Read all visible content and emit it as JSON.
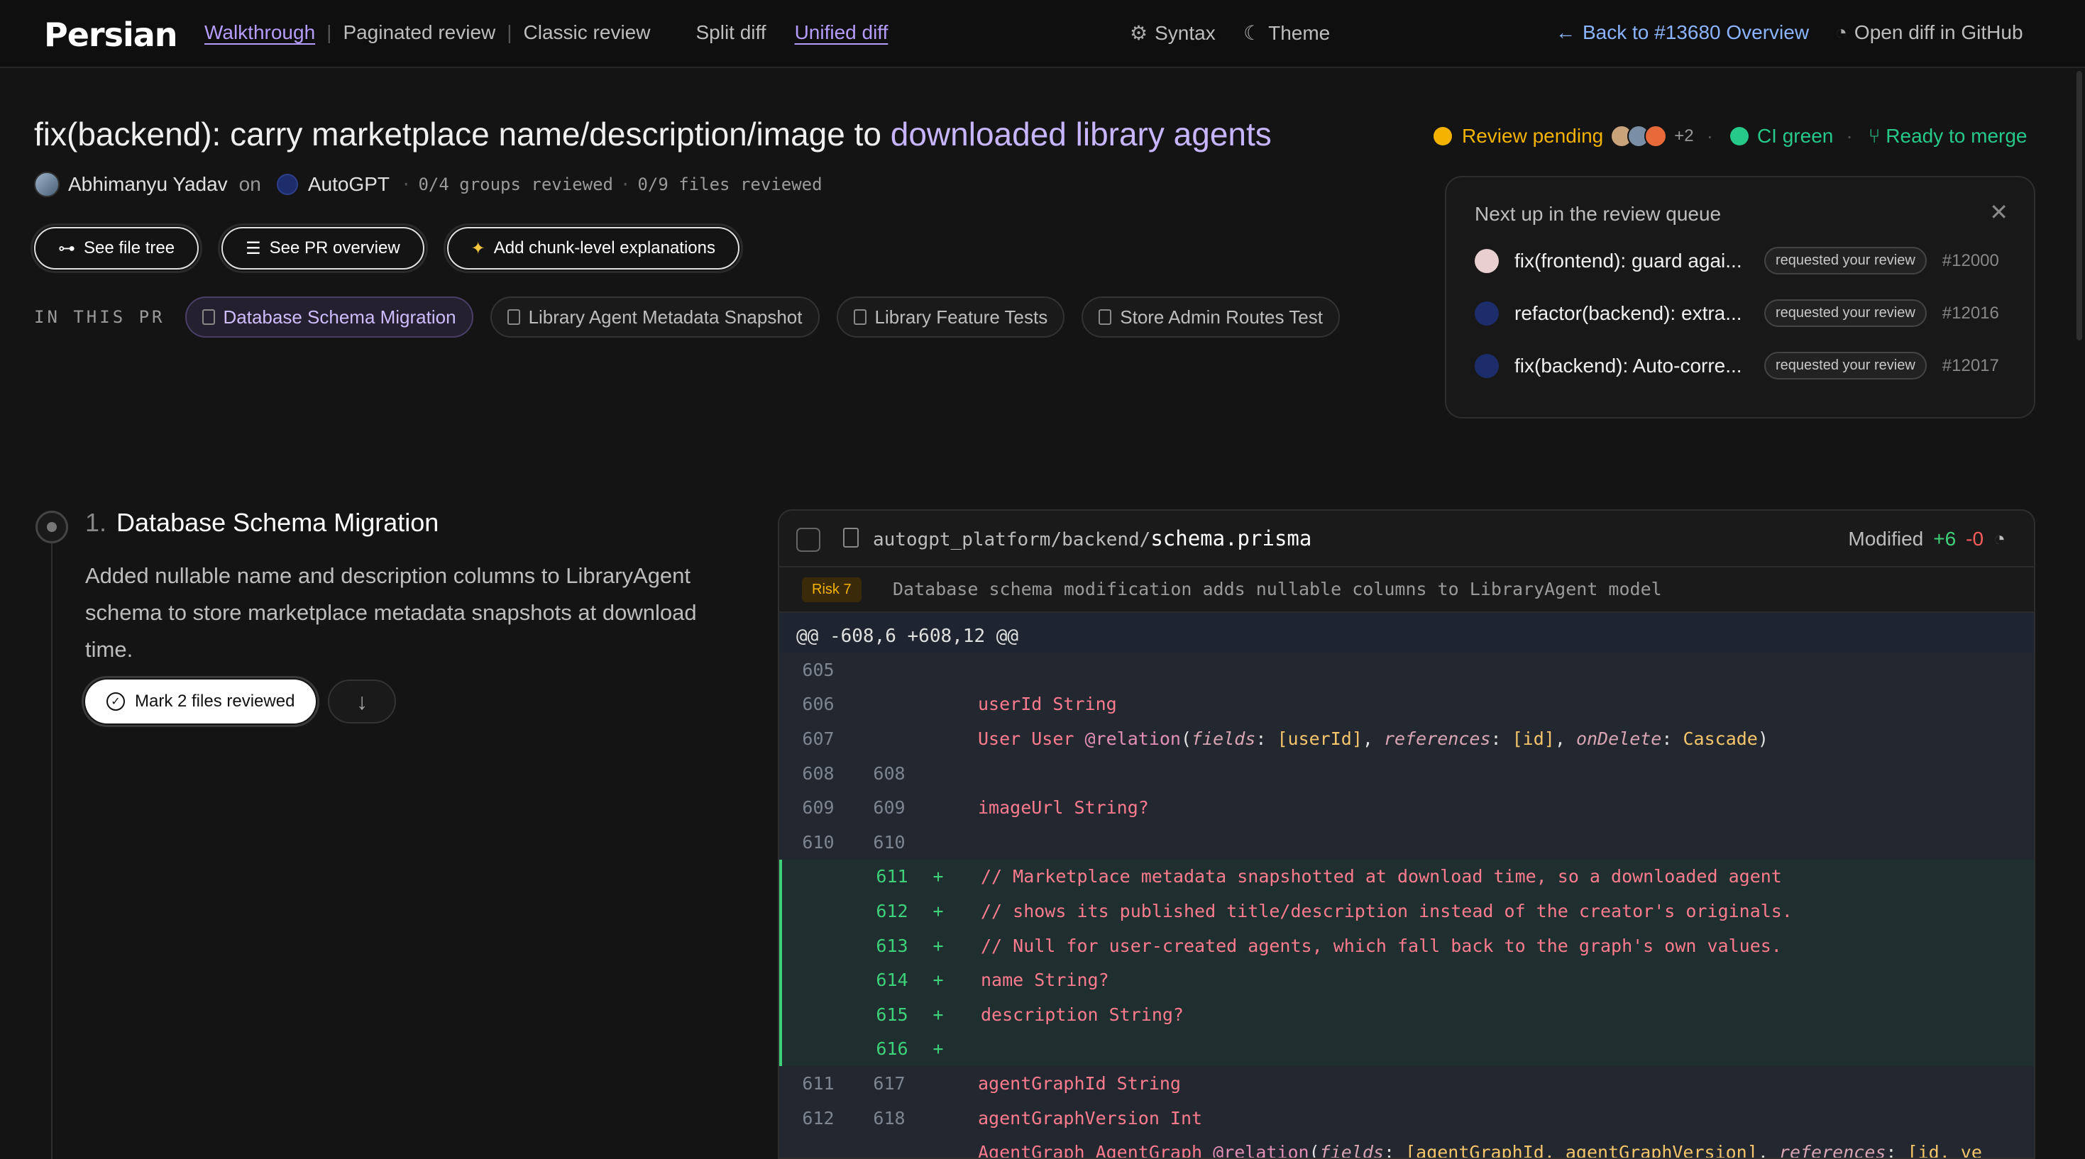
{
  "nav": {
    "logo": "Persian",
    "links": [
      "Walkthrough",
      "Paginated review",
      "Classic review"
    ],
    "diff_modes": [
      "Split diff",
      "Unified diff"
    ],
    "syntax": "Syntax",
    "theme": "Theme",
    "back": "Back to #13680 Overview",
    "open_github": "Open diff in GitHub"
  },
  "pr": {
    "title_plain": "fix(backend): carry marketplace name/description/image to ",
    "title_highlight": "downloaded library agents",
    "author": "Abhimanyu Yadav",
    "on": "on",
    "repo": "AutoGPT",
    "groups_reviewed": "0/4 groups reviewed",
    "files_reviewed": "0/9 files reviewed"
  },
  "status": {
    "review": "Review pending",
    "extra_reviewers": "+2",
    "ci": "CI green",
    "merge": "Ready to merge",
    "colors": {
      "pending": "#f5b301",
      "green": "#27c98b"
    }
  },
  "actions": {
    "file_tree": "See file tree",
    "pr_overview": "See PR overview",
    "explanations": "Add chunk-level explanations"
  },
  "in_this_pr": {
    "label": "IN THIS PR",
    "chips": [
      "Database Schema Migration",
      "Library Agent Metadata Snapshot",
      "Library Feature Tests",
      "Store Admin Routes Test"
    ]
  },
  "queue": {
    "title": "Next up in the review queue",
    "items": [
      {
        "title": "fix(frontend): guard agai...",
        "badge": "requested your review",
        "num": "#12000"
      },
      {
        "title": "refactor(backend): extra...",
        "badge": "requested your review",
        "num": "#12016"
      },
      {
        "title": "fix(backend): Auto-corre...",
        "badge": "requested your review",
        "num": "#12017"
      }
    ]
  },
  "section": {
    "number": "1.",
    "title": "Database Schema Migration",
    "description": "Added nullable name and description columns to LibraryAgent schema to store marketplace metadata snapshots at download time.",
    "mark_button": "Mark 2 files reviewed"
  },
  "diff": {
    "path": "autogpt_platform/backend/",
    "filename": "schema.prisma",
    "status": "Modified",
    "additions": "+6",
    "deletions": "-0",
    "risk": "Risk 7",
    "risk_text": "Database schema modification adds nullable columns to LibraryAgent model",
    "hunk": "@@ -608,6 +608,12 @@"
  }
}
